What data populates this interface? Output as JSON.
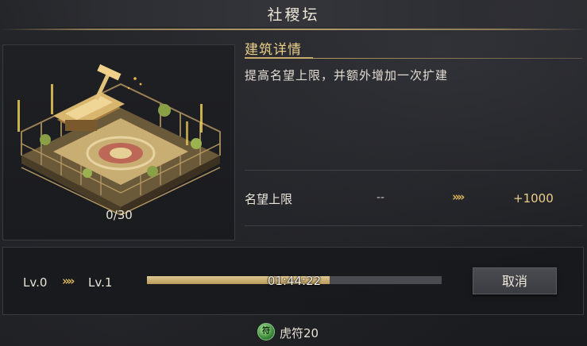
{
  "title": "社稷坛",
  "building": {
    "level_count": "0/30"
  },
  "details": {
    "section_title": "建筑详情",
    "description": "提高名望上限，并额外增加一次扩建",
    "stat": {
      "label": "名望上限",
      "current": "--",
      "arrow": "»",
      "next": "+1000"
    }
  },
  "upgrade": {
    "level_from": "Lv.0",
    "arrow": "»",
    "level_to": "Lv.1",
    "progress_fraction": 0.62,
    "time_remaining": "01:44:22",
    "cancel_label": "取消"
  },
  "cost": {
    "icon": "tiger-tally-icon",
    "icon_glyph": "符",
    "label": "虎符20"
  },
  "colors": {
    "accent_gold": "#e9cf8a",
    "progress_fill": "#cdb27a"
  }
}
